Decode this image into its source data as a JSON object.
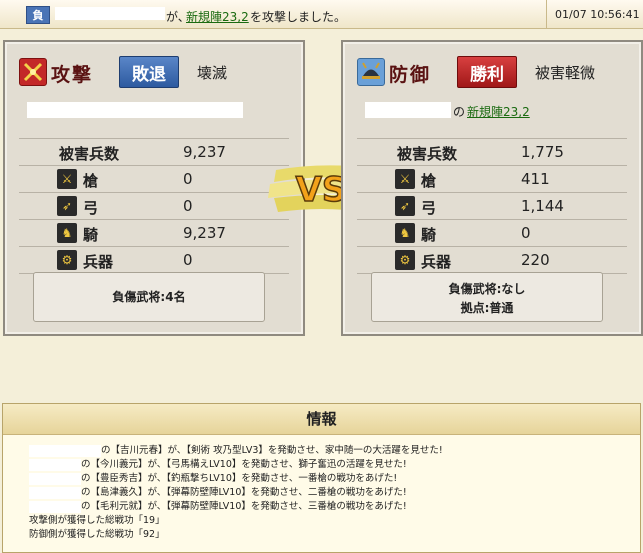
{
  "topbar": {
    "result": "負",
    "message_mid": "が、",
    "target_link": "新規陣23,2",
    "message_end": "を攻撃しました。",
    "timestamp": "01/07 10:56:41"
  },
  "attack": {
    "title": "攻撃",
    "outcome": "敗退",
    "damage_level": "壊滅",
    "total_label": "被害兵数",
    "total": "9,237",
    "units": [
      {
        "label": "槍",
        "icon": "spear-icon",
        "value": "0"
      },
      {
        "label": "弓",
        "icon": "bow-icon",
        "value": "0"
      },
      {
        "label": "騎",
        "icon": "horse-icon",
        "value": "9,237"
      },
      {
        "label": "兵器",
        "icon": "siege-icon",
        "value": "0"
      }
    ],
    "injured_generals": "負傷武将:4名"
  },
  "defense": {
    "title": "防御",
    "outcome": "勝利",
    "damage_level": "被害軽微",
    "location_of": "の",
    "location_link": "新規陣23,2",
    "total_label": "被害兵数",
    "total": "1,775",
    "units": [
      {
        "label": "槍",
        "icon": "spear-icon",
        "value": "411"
      },
      {
        "label": "弓",
        "icon": "bow-icon",
        "value": "1,144"
      },
      {
        "label": "騎",
        "icon": "horse-icon",
        "value": "0"
      },
      {
        "label": "兵器",
        "icon": "siege-icon",
        "value": "220"
      }
    ],
    "injured_generals": "負傷武将:なし",
    "stronghold": "拠点:普通"
  },
  "vs_label": "VS",
  "info": {
    "title": "情報",
    "lines": [
      "の【吉川元春】が、【剣術 攻乃型LV3】を発動させ、家中随一の大活躍を見せた!",
      "の【今川義元】が、【弓馬構えLV10】を発動させ、獅子奮迅の活躍を見せた!",
      "の【豊臣秀吉】が、【釣瓶撃ちLV10】を発動させ、一番槍の戦功をあげた!",
      "の【島津義久】が、【弾幕防壁陣LV10】を発動させ、二番槍の戦功をあげた!",
      "の【毛利元就】が、【弾幕防壁陣LV10】を発動させ、三番槍の戦功をあげた!"
    ],
    "attack_merit": "攻撃側が獲得した総戦功「19」",
    "defense_merit": "防御側が獲得した総戦功「92」"
  },
  "colors": {
    "attack_accent": "#c32828",
    "defense_accent": "#3a6a9a",
    "link": "#1a6a10"
  }
}
